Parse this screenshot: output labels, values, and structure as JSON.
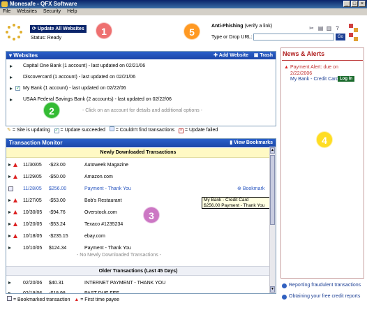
{
  "window": {
    "title": "Monesafe - QFX Software"
  },
  "menu": [
    "File",
    "Websites",
    "Security",
    "Help"
  ],
  "toolbar": {
    "update_label": "Update All Websites",
    "status": "Status: Ready"
  },
  "badges": [
    "1",
    "2",
    "3",
    "4",
    "5"
  ],
  "anti_phishing": {
    "title": "Anti-Phishing",
    "verify": "(verify a link)",
    "label": "Type or Drop URL:",
    "placeholder": "",
    "go": "Go"
  },
  "websites": {
    "title": "Websites",
    "add": "Add Website",
    "trash": "Trash",
    "rows": [
      {
        "text": "Capital One Bank (1 account) - last updated on 02/21/06",
        "checked": false
      },
      {
        "text": "Discovercard (1 account) - last updated on 02/21/06",
        "checked": false
      },
      {
        "text": "My Bank (1 account) - last updated on 02/22/06",
        "checked": true
      },
      {
        "text": "USAA Federal Savings Bank (2 accounts) - last updated on 02/22/06",
        "checked": false
      }
    ],
    "hint": "- Click on an account for details and additional options -"
  },
  "legend1": {
    "updating": "= Site is updating",
    "succeeded": "= Update succeeded",
    "couldnt": "= Couldn't find transactions",
    "failed": "= Update failed"
  },
  "transactions": {
    "title": "Transaction Monitor",
    "view_bookmarks": "View Bookmarks",
    "new_header": "Newly Downloaded Transactions",
    "rows": [
      {
        "date": "11/30/05",
        "amount": "-$23.00",
        "payee": "Autoweek Magazine"
      },
      {
        "date": "11/29/05",
        "amount": "-$50.00",
        "payee": "Amazon.com"
      },
      {
        "date": "11/28/05",
        "amount": "$256.00",
        "payee": "Payment - Thank You"
      },
      {
        "date": "11/27/05",
        "amount": "-$53.00",
        "payee": "Bob's Restaurant"
      },
      {
        "date": "10/30/05",
        "amount": "-$94.76",
        "payee": "Overstock.com"
      },
      {
        "date": "10/20/05",
        "amount": "-$53.24",
        "payee": "Texaco #1235234"
      },
      {
        "date": "10/18/05",
        "amount": "-$235.15",
        "payee": "ebay.com"
      },
      {
        "date": "10/10/05",
        "amount": "$124.34",
        "payee": "Payment - Thank You"
      }
    ],
    "bookmark": "Bookmark",
    "tooltip_line1": "My Bank - Credit Card",
    "tooltip_line2": "$256.00        Payment - Thank You",
    "no_new": "- No Newly Downloaded Transactions -",
    "older_header": "Older Transactions (Last 45 Days)",
    "older_rows": [
      {
        "date": "02/20/06",
        "amount": "$40.31",
        "payee": "INTERNET PAYMENT - THANK YOU"
      },
      {
        "date": "02/18/06",
        "amount": "-$18.98",
        "payee": "PAST DUE FEE"
      }
    ]
  },
  "legend2": {
    "bookmarked": "= Bookmarked transaction",
    "first_time": "= First time payee"
  },
  "news": {
    "title": "News & Alerts",
    "alert": "Payment Alert: due on 2/22/2006",
    "account": "My Bank - Credit Card",
    "login": "Log In",
    "links": [
      "Reporting fraudulent transactions",
      "Obtaining your free credit reports"
    ]
  },
  "colors": {
    "accent": "#1c47a8",
    "badge_red": "#ee7070",
    "badge_green": "#33bb33",
    "badge_pink": "#cc77c4",
    "badge_yellow": "#ffdd22",
    "badge_orange": "#ff9922"
  }
}
